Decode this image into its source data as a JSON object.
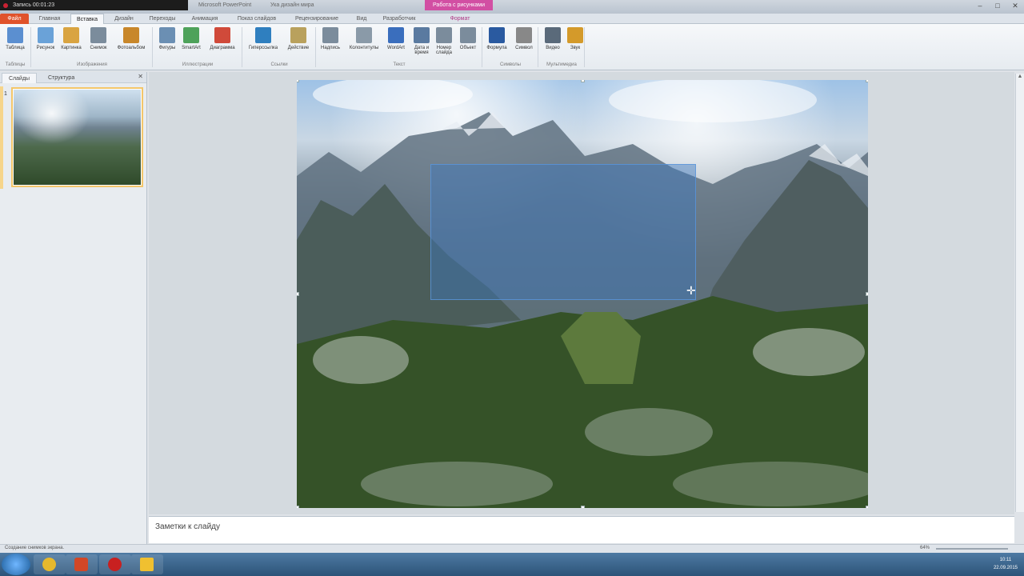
{
  "titlebar": {
    "recorder": "Запись 00:01:23",
    "window_title": "Microsoft PowerPoint",
    "document": "Ука дизайн мира",
    "context_tab": "Работа с рисунками"
  },
  "tabs": {
    "file": "Файл",
    "items": [
      "Главная",
      "Вставка",
      "Дизайн",
      "Переходы",
      "Анимация",
      "Показ слайдов",
      "Рецензирование",
      "Вид",
      "Разработчик"
    ],
    "active": "Вставка",
    "context": "Формат"
  },
  "ribbon": {
    "buttons": [
      {
        "label": "Таблица",
        "icon": "table-icon",
        "color": "#5b8fd0"
      },
      {
        "label": "Рисунок",
        "icon": "picture-icon",
        "color": "#6aa2d8"
      },
      {
        "label": "Картинка",
        "icon": "clipart-icon",
        "color": "#d9a441"
      },
      {
        "label": "Снимок",
        "icon": "screenshot-icon",
        "color": "#7b8c9c"
      },
      {
        "label": "Фотоальбом",
        "icon": "photo-album-icon",
        "color": "#c8872a"
      },
      {
        "label": "Фигуры",
        "icon": "shapes-icon",
        "color": "#6b8fb3"
      },
      {
        "label": "SmartArt",
        "icon": "smartart-icon",
        "color": "#4ea25a"
      },
      {
        "label": "Диаграмма",
        "icon": "chart-icon",
        "color": "#d04a3a"
      },
      {
        "label": "Гиперссылка",
        "icon": "hyperlink-icon",
        "color": "#2f7fbf"
      },
      {
        "label": "Действие",
        "icon": "action-icon",
        "color": "#b9a15d"
      },
      {
        "label": "Надпись",
        "icon": "textbox-icon",
        "color": "#7b8c9c"
      },
      {
        "label": "Колонтитулы",
        "icon": "header-footer-icon",
        "color": "#8a9aa8"
      },
      {
        "label": "WordArt",
        "icon": "wordart-icon",
        "color": "#3a6ebd"
      },
      {
        "label": "Дата и время",
        "icon": "datetime-icon",
        "color": "#5a7aa0"
      },
      {
        "label": "Номер слайда",
        "icon": "slide-number-icon",
        "color": "#7b8c9c"
      },
      {
        "label": "Объект",
        "icon": "object-icon",
        "color": "#7b8c9c"
      },
      {
        "label": "Формула",
        "icon": "equation-icon",
        "color": "#2a5aa0"
      },
      {
        "label": "Символ",
        "icon": "symbol-icon",
        "color": "#888888"
      },
      {
        "label": "Видео",
        "icon": "video-icon",
        "color": "#5a6a7a"
      },
      {
        "label": "Звук",
        "icon": "audio-icon",
        "color": "#d49a2a"
      }
    ],
    "groups": [
      "Таблицы",
      "Изображения",
      "Иллюстрации",
      "Ссылки",
      "Текст",
      "Символы",
      "Мультимедиа"
    ]
  },
  "leftpane": {
    "tabs": [
      "Слайды",
      "Структура"
    ],
    "slide_number": "1"
  },
  "notes": {
    "placeholder": "Заметки к слайду"
  },
  "status": {
    "left": "Создание снимков экрана.",
    "zoom": "64%"
  },
  "taskbar": {
    "apps": [
      {
        "name": "chrome",
        "color": "#e5b82d"
      },
      {
        "name": "powerpoint",
        "color": "#d24726"
      },
      {
        "name": "recorder",
        "color": "#c82020"
      },
      {
        "name": "other",
        "color": "#f0c030"
      }
    ],
    "time": "10:11",
    "date": "22.09.2015"
  }
}
